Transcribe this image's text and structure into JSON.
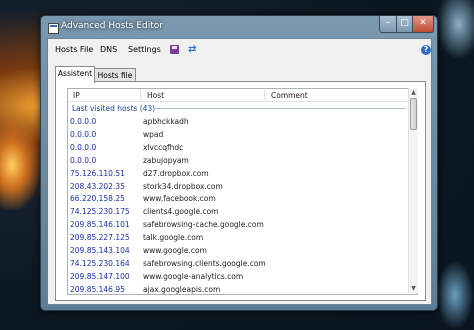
{
  "window": {
    "title": "Advanced Hosts Editor",
    "minimize": "–",
    "maximize": "□",
    "close": "✕"
  },
  "menu": {
    "hosts_file": "Hosts File",
    "dns": "DNS",
    "settings": "Settings",
    "help": "?"
  },
  "toolbar": {
    "save_icon": "save-icon",
    "refresh_icon": "refresh-icon",
    "refresh_glyph": "⇄"
  },
  "tabs": {
    "assistent": "Assistent",
    "hosts_file": "Hosts file"
  },
  "list": {
    "columns": {
      "ip": "IP",
      "host": "Host",
      "comment": "Comment"
    },
    "group_title": "Last visited hosts (43)",
    "rows": [
      {
        "ip": "0.0.0.0",
        "host": "apbhckkadh"
      },
      {
        "ip": "0.0.0.0",
        "host": "wpad"
      },
      {
        "ip": "0.0.0.0",
        "host": "xlvccqfhdc"
      },
      {
        "ip": "0.0.0.0",
        "host": "zabujopyam"
      },
      {
        "ip": "75.126.110.51",
        "host": "d27.dropbox.com"
      },
      {
        "ip": "208.43.202.35",
        "host": "stork34.dropbox.com"
      },
      {
        "ip": "66.220.158.25",
        "host": "www.facebook.com"
      },
      {
        "ip": "74.125.230.175",
        "host": "clients4.google.com"
      },
      {
        "ip": "209.85.146.101",
        "host": "safebrowsing-cache.google.com"
      },
      {
        "ip": "209.85.227.125",
        "host": "talk.google.com"
      },
      {
        "ip": "209.85.143.104",
        "host": "www.google.com"
      },
      {
        "ip": "74.125.230.164",
        "host": "safebrowsing.clients.google.com"
      },
      {
        "ip": "209.85.147.100",
        "host": "www.google-analytics.com"
      },
      {
        "ip": "209.85.146.95",
        "host": "ajax.googleapis.com"
      }
    ]
  },
  "colors": {
    "ip_text": "#1a2ea8",
    "group_text": "#1e3fa0"
  }
}
